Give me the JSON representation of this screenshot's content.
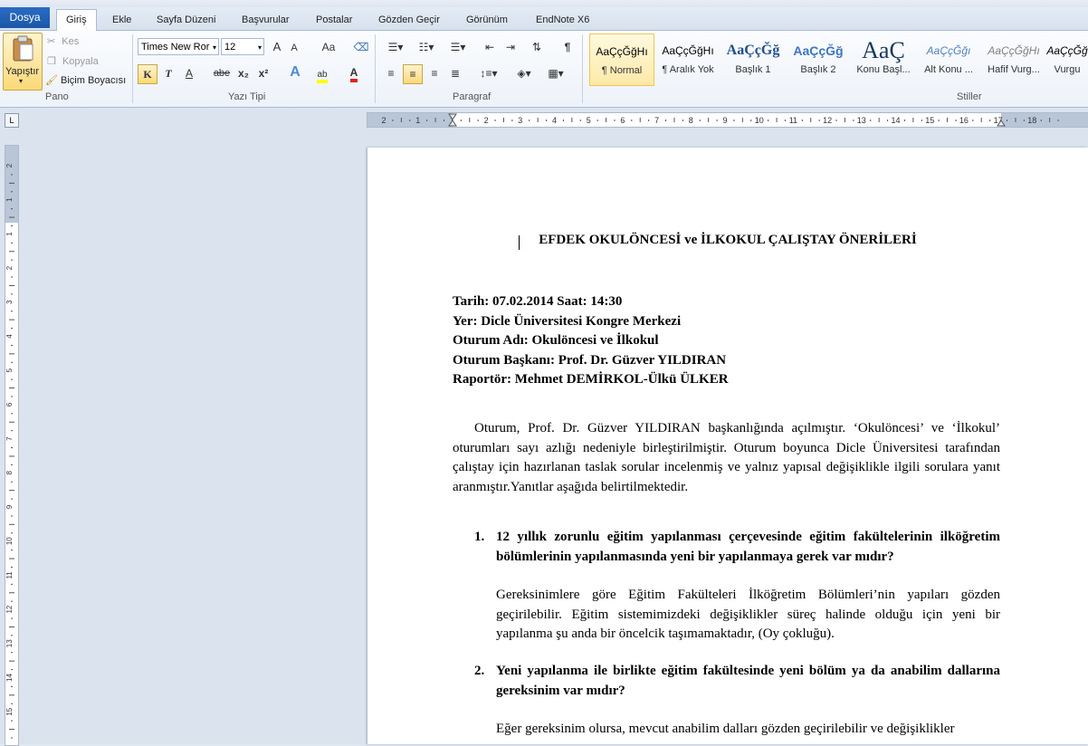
{
  "tabs": {
    "file": "Dosya",
    "items": [
      "Giriş",
      "Ekle",
      "Sayfa Düzeni",
      "Başvurular",
      "Postalar",
      "Gözden Geçir",
      "Görünüm",
      "EndNote X6"
    ]
  },
  "ribbon": {
    "clipboard": {
      "paste": "Yapıştır",
      "cut": "Kes",
      "copy": "Kopyala",
      "format_painter": "Biçim Boyacısı",
      "group": "Pano"
    },
    "font": {
      "family": "Times New Ror",
      "size": "12",
      "group": "Yazı Tipi",
      "bold": "K",
      "italic": "T",
      "underline": "A",
      "strike": "abe",
      "sub": "x₂",
      "sup": "x²",
      "case": "Aa",
      "grow": "A",
      "shrink": "A"
    },
    "paragraph": {
      "group": "Paragraf",
      "pilcrow": "¶"
    },
    "styles": {
      "group": "Stiller",
      "items": [
        {
          "preview": "AaÇçĞğHı",
          "name": "¶ Normal"
        },
        {
          "preview": "AaÇçĞğHı",
          "name": "¶ Aralık Yok"
        },
        {
          "preview": "AaÇçĞğ",
          "name": "Başlık 1"
        },
        {
          "preview": "AaÇçĞğ",
          "name": "Başlık 2"
        },
        {
          "preview": "AaÇ",
          "name": "Konu Başl..."
        },
        {
          "preview": "AaÇçĞğı",
          "name": "Alt Konu ..."
        },
        {
          "preview": "AaÇçĞğHı",
          "name": "Hafif Vurg..."
        },
        {
          "preview": "AaÇçĞğ",
          "name": "Vurgu"
        }
      ]
    }
  },
  "ruler": {
    "labels": [
      "2",
      "1",
      "1",
      "2",
      "3",
      "4",
      "5",
      "6",
      "7",
      "8",
      "9",
      "10",
      "11",
      "12",
      "13",
      "14",
      "15",
      "16",
      "17",
      "18"
    ]
  },
  "vruler": {
    "labels": [
      "2",
      "1",
      "1",
      "2",
      "3",
      "4",
      "5",
      "6",
      "7",
      "8",
      "9",
      "10",
      "11",
      "12",
      "13",
      "14",
      "15",
      "16",
      "17",
      "18"
    ]
  },
  "document": {
    "title": "EFDEK OKULÖNCESİ ve İLKOKUL ÇALIŞTAY ÖNERİLERİ",
    "meta": [
      "Tarih: 07.02.2014 Saat: 14:30",
      "Yer: Dicle Üniversitesi Kongre Merkezi",
      "Oturum Adı: Okulöncesi ve İlkokul",
      "Oturum Başkanı: Prof. Dr. Güzver YILDIRAN",
      "Raportör: Mehmet DEMİRKOL-Ülkü ÜLKER"
    ],
    "intro": "Oturum, Prof. Dr. Güzver YILDIRAN başkanlığında açılmıştır. ‘Okulöncesi’ ve ‘İlkokul’ oturumları sayı azlığı nedeniyle birleştirilmiştir. Oturum boyunca Dicle Üniversitesi tarafından çalıştay için hazırlanan taslak sorular incelenmiş ve yalnız yapısal değişiklikle ilgili sorulara yanıt aranmıştır.Yanıtlar aşağıda belirtilmektedir.",
    "questions": [
      {
        "num": "1.",
        "question": "12 yıllık zorunlu eğitim yapılanması çerçevesinde eğitim fakültelerinin ilköğretim bölümlerinin yapılanmasında yeni bir yapılanmaya gerek var mıdır?",
        "answer": "Gereksinimlere göre Eğitim Fakülteleri İlköğretim Bölümleri’nin yapıları gözden geçirilebilir. Eğitim sistemimizdeki değişiklikler süreç halinde olduğu için yeni bir yapılanma şu anda bir öncelcik taşımamaktadır, (Oy çokluğu)."
      },
      {
        "num": "2.",
        "question": "Yeni yapılanma ile birlikte eğitim fakültesinde yeni bölüm ya da anabilim dallarına gereksinim var mıdır?",
        "answer": "Eğer gereksinim olursa, mevcut anabilim dalları gözden geçirilebilir ve değişiklikler"
      }
    ]
  }
}
